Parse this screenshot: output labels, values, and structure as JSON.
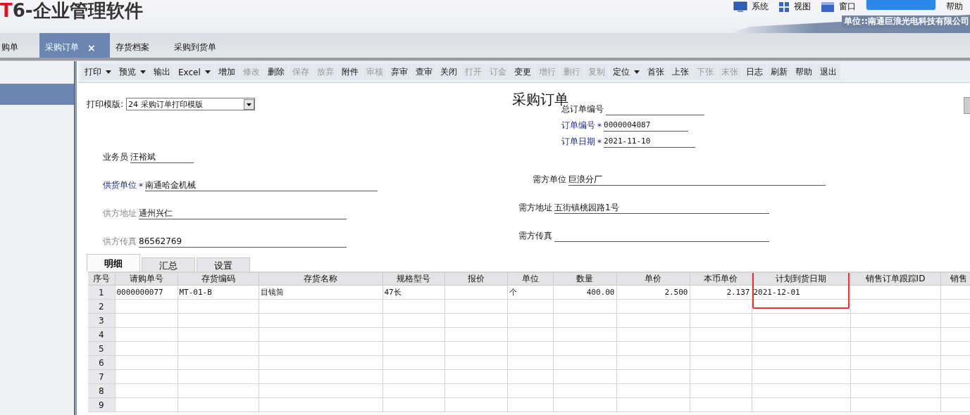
{
  "app_header": {
    "logo_mark": "T",
    "logo_text": "6-企业管理软件",
    "menu": [
      {
        "label": "系统"
      },
      {
        "label": "视图"
      },
      {
        "label": "窗口"
      },
      {
        "label": "帮助"
      }
    ],
    "company": "单位::南通巨浪光电科技有限公司"
  },
  "doc_tabs": [
    {
      "label": "购单",
      "selected": false,
      "closable": false
    },
    {
      "label": "采购订单",
      "selected": true,
      "closable": true,
      "close_icon": "×"
    },
    {
      "label": "存货档案",
      "selected": false,
      "closable": false
    },
    {
      "label": "采购到货单",
      "selected": false,
      "closable": false
    }
  ],
  "sidebar": {
    "items": [
      {
        "selected": true
      }
    ]
  },
  "toolbar": [
    {
      "label": "打印",
      "disabled": false,
      "dropdown": true
    },
    {
      "label": "预览",
      "disabled": false,
      "dropdown": true
    },
    {
      "label": "输出",
      "disabled": false,
      "dropdown": false
    },
    {
      "label": "Excel",
      "disabled": false,
      "dropdown": true
    },
    {
      "label": "增加",
      "disabled": false,
      "dropdown": false
    },
    {
      "label": "修改",
      "disabled": true,
      "dropdown": false
    },
    {
      "label": "删除",
      "disabled": false,
      "dropdown": false
    },
    {
      "label": "保存",
      "disabled": true,
      "dropdown": false
    },
    {
      "label": "放弃",
      "disabled": true,
      "dropdown": false
    },
    {
      "label": "附件",
      "disabled": false,
      "dropdown": false
    },
    {
      "label": "审核",
      "disabled": true,
      "dropdown": false
    },
    {
      "label": "弃审",
      "disabled": false,
      "dropdown": false
    },
    {
      "label": "查审",
      "disabled": false,
      "dropdown": false
    },
    {
      "label": "关闭",
      "disabled": false,
      "dropdown": false
    },
    {
      "label": "打开",
      "disabled": true,
      "dropdown": false
    },
    {
      "label": "订金",
      "disabled": true,
      "dropdown": false
    },
    {
      "label": "变更",
      "disabled": false,
      "dropdown": false
    },
    {
      "label": "增行",
      "disabled": true,
      "dropdown": false
    },
    {
      "label": "删行",
      "disabled": true,
      "dropdown": false
    },
    {
      "label": "复制",
      "disabled": true,
      "dropdown": false
    },
    {
      "label": "定位",
      "disabled": false,
      "dropdown": true
    },
    {
      "label": "首张",
      "disabled": false,
      "dropdown": false
    },
    {
      "label": "上张",
      "disabled": false,
      "dropdown": false
    },
    {
      "label": "下张",
      "disabled": true,
      "dropdown": false
    },
    {
      "label": "末张",
      "disabled": true,
      "dropdown": false
    },
    {
      "label": "日志",
      "disabled": false,
      "dropdown": false
    },
    {
      "label": "刷新",
      "disabled": false,
      "dropdown": false
    },
    {
      "label": "帮助",
      "disabled": false,
      "dropdown": false
    },
    {
      "label": "退出",
      "disabled": false,
      "dropdown": false
    }
  ],
  "form": {
    "print_template": {
      "label": "打印模版:",
      "value": "24 采购订单打印模版"
    },
    "title": "采购订单",
    "top_fields": [
      {
        "label": "总订单编号",
        "required": false,
        "disabled": false
      },
      {
        "label": "订单编号",
        "required": true,
        "disabled": false,
        "value": "0000004087"
      },
      {
        "label": "订单日期",
        "required": true,
        "disabled": false,
        "value": "2021-11-10"
      }
    ],
    "left_fields": [
      {
        "label": "业务员",
        "required": false,
        "disabled": false,
        "value": "汪裕斌"
      },
      {
        "label": "供货单位",
        "required": true,
        "disabled": false,
        "value": "南通哈金机械"
      },
      {
        "label": "供方地址",
        "required": false,
        "disabled": true,
        "value": "通州兴仁"
      },
      {
        "label": "供方传真",
        "required": false,
        "disabled": true,
        "value": "86562769"
      }
    ],
    "right_fields": [
      {
        "label": "需方单位",
        "required": false,
        "disabled": false,
        "value": "巨浪分厂"
      },
      {
        "label": "需方地址",
        "required": false,
        "disabled": false,
        "value": "五街镇桃园路1号"
      },
      {
        "label": "需方传真",
        "required": false,
        "disabled": false
      }
    ],
    "required_mark": "*"
  },
  "detail_tabs": [
    {
      "label": "明细",
      "selected": true
    },
    {
      "label": "汇总",
      "selected": false
    },
    {
      "label": "设置",
      "selected": false
    }
  ],
  "table": {
    "columns": [
      {
        "label": "序号",
        "kind": "index",
        "highlighted": false
      },
      {
        "label": "请购单号",
        "kind": "text",
        "highlighted": false
      },
      {
        "label": "存货编码",
        "kind": "text",
        "highlighted": false
      },
      {
        "label": "存货名称",
        "kind": "text",
        "highlighted": false
      },
      {
        "label": "规格型号",
        "kind": "text",
        "highlighted": false
      },
      {
        "label": "报价",
        "kind": "number",
        "highlighted": false
      },
      {
        "label": "单位",
        "kind": "text",
        "highlighted": false
      },
      {
        "label": "数量",
        "kind": "number",
        "highlighted": false
      },
      {
        "label": "单价",
        "kind": "number",
        "highlighted": false
      },
      {
        "label": "本币单价",
        "kind": "number",
        "highlighted": false
      },
      {
        "label": "计划到货日期",
        "kind": "text",
        "highlighted": true
      },
      {
        "label": "销售订单跟踪ID",
        "kind": "text",
        "highlighted": false
      },
      {
        "label": "销售",
        "kind": "text",
        "highlighted": false
      }
    ],
    "rows": [
      {
        "cells": [
          "1",
          "0000000077",
          "MT-01-B",
          "目镜筒",
          "47长",
          null,
          "个",
          "400.00",
          "2.500",
          "2.137",
          "2021-12-01"
        ]
      },
      {
        "cells": [
          "2"
        ]
      },
      {
        "cells": [
          "3"
        ]
      },
      {
        "cells": [
          "4"
        ]
      },
      {
        "cells": [
          "5"
        ]
      },
      {
        "cells": [
          "6"
        ]
      },
      {
        "cells": [
          "7"
        ]
      },
      {
        "cells": [
          "8"
        ]
      },
      {
        "cells": [
          "9"
        ]
      }
    ]
  }
}
